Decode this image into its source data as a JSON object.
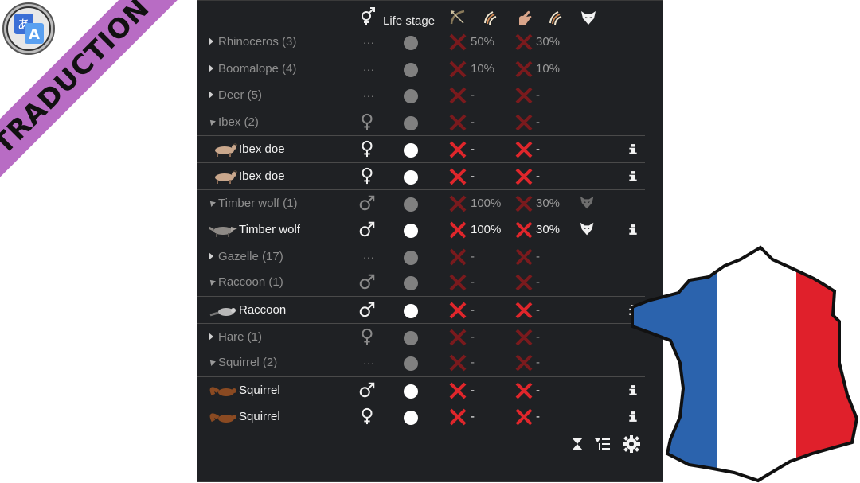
{
  "banner": {
    "label": "TRADUCTION"
  },
  "header": {
    "life_stage_label": "Life stage",
    "icons": [
      "gender-icon",
      "bow-icon",
      "claws-icon",
      "hand-icon",
      "claws-icon",
      "wolf-head-icon"
    ]
  },
  "rows": [
    {
      "type": "group",
      "name": "Rhinoceros (3)",
      "expanded": false,
      "sex": "...",
      "v1": "50%",
      "v2": "30%"
    },
    {
      "type": "group",
      "name": "Boomalope (4)",
      "expanded": false,
      "sex": "...",
      "v1": "10%",
      "v2": "10%"
    },
    {
      "type": "group",
      "name": "Deer (5)",
      "expanded": false,
      "sex": "...",
      "v1": "-",
      "v2": "-"
    },
    {
      "type": "group",
      "name": "Ibex (2)",
      "expanded": true,
      "sex": "female",
      "v1": "-",
      "v2": "-"
    },
    {
      "type": "animal",
      "name": "Ibex doe",
      "sex": "female",
      "v1": "-",
      "v2": "-"
    },
    {
      "type": "animal",
      "name": "Ibex doe",
      "sex": "female",
      "v1": "-",
      "v2": "-"
    },
    {
      "type": "group",
      "name": "Timber wolf (1)",
      "expanded": true,
      "sex": "male",
      "v1": "100%",
      "v2": "30%"
    },
    {
      "type": "animal",
      "name": "Timber wolf",
      "sex": "male",
      "v1": "100%",
      "v2": "30%"
    },
    {
      "type": "group",
      "name": "Gazelle (17)",
      "expanded": false,
      "sex": "...",
      "v1": "-",
      "v2": "-"
    },
    {
      "type": "group",
      "name": "Raccoon (1)",
      "expanded": true,
      "sex": "male",
      "v1": "-",
      "v2": "-"
    },
    {
      "type": "animal",
      "name": "Raccoon",
      "sex": "male",
      "v1": "-",
      "v2": "-"
    },
    {
      "type": "group",
      "name": "Hare (1)",
      "expanded": false,
      "sex": "female",
      "v1": "-",
      "v2": "-"
    },
    {
      "type": "group",
      "name": "Squirrel (2)",
      "expanded": true,
      "sex": "...",
      "v1": "-",
      "v2": "-"
    },
    {
      "type": "animal",
      "name": "Squirrel",
      "sex": "male",
      "v1": "-",
      "v2": "-"
    },
    {
      "type": "animal",
      "name": "Squirrel",
      "sex": "female",
      "v1": "-",
      "v2": "-"
    }
  ],
  "footer": {
    "icons": [
      "hourglass-icon",
      "sort-list-icon",
      "gear-icon"
    ]
  },
  "colors": {
    "panel_bg": "#1f2124",
    "x_red": "#e0262b",
    "ribbon": "#b86cc4"
  }
}
